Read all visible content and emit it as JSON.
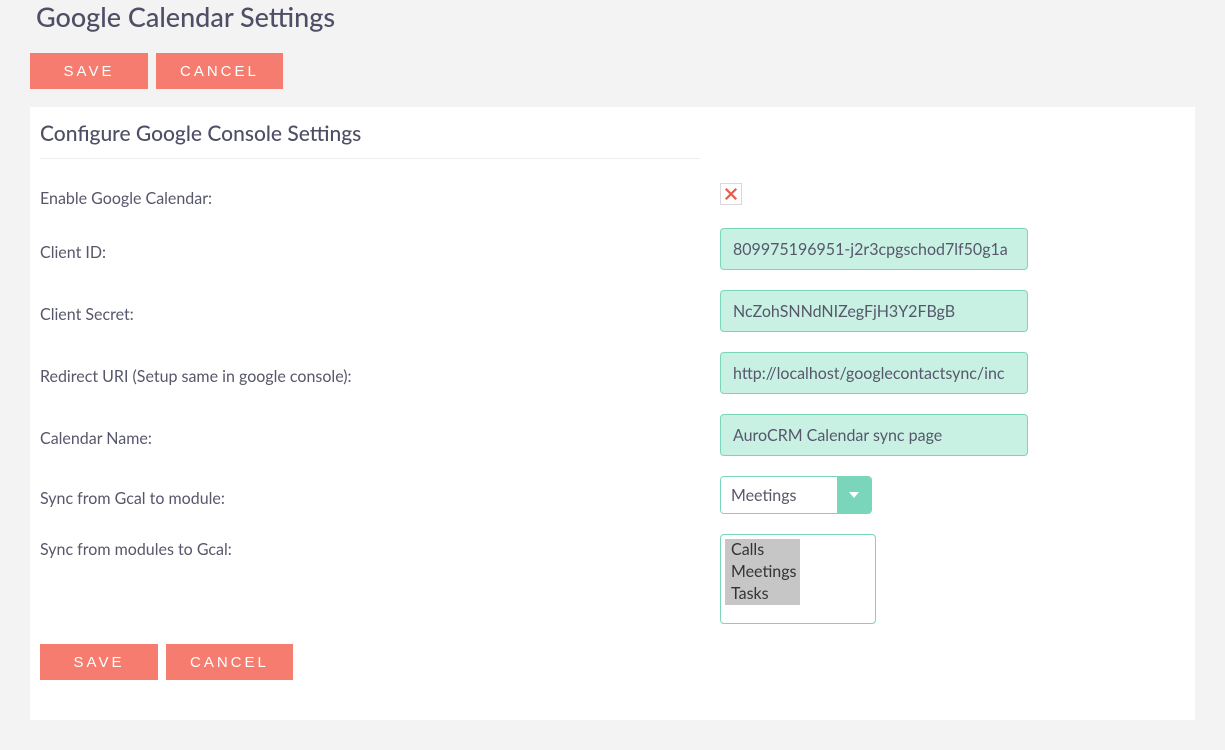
{
  "page_title": "Google Calendar Settings",
  "buttons": {
    "save": "SAVE",
    "cancel": "CANCEL"
  },
  "section_title": "Configure Google Console Settings",
  "fields": {
    "enable_google_calendar": {
      "label": "Enable Google Calendar:",
      "checked": false
    },
    "client_id": {
      "label": "Client ID:",
      "value": "809975196951-j2r3cpgschod7lf50g1a"
    },
    "client_secret": {
      "label": "Client Secret:",
      "value": "NcZohSNNdNIZegFjH3Y2FBgB"
    },
    "redirect_uri": {
      "label": "Redirect URI (Setup same in google console):",
      "value": "http://localhost/googlecontactsync/inc"
    },
    "calendar_name": {
      "label": "Calendar Name:",
      "value": "AuroCRM Calendar sync page"
    },
    "sync_from_gcal": {
      "label": "Sync from Gcal to module:",
      "selected": "Meetings"
    },
    "sync_to_gcal": {
      "label": "Sync from modules to Gcal:",
      "options": [
        "Calls",
        "Meetings",
        "Tasks"
      ]
    }
  }
}
